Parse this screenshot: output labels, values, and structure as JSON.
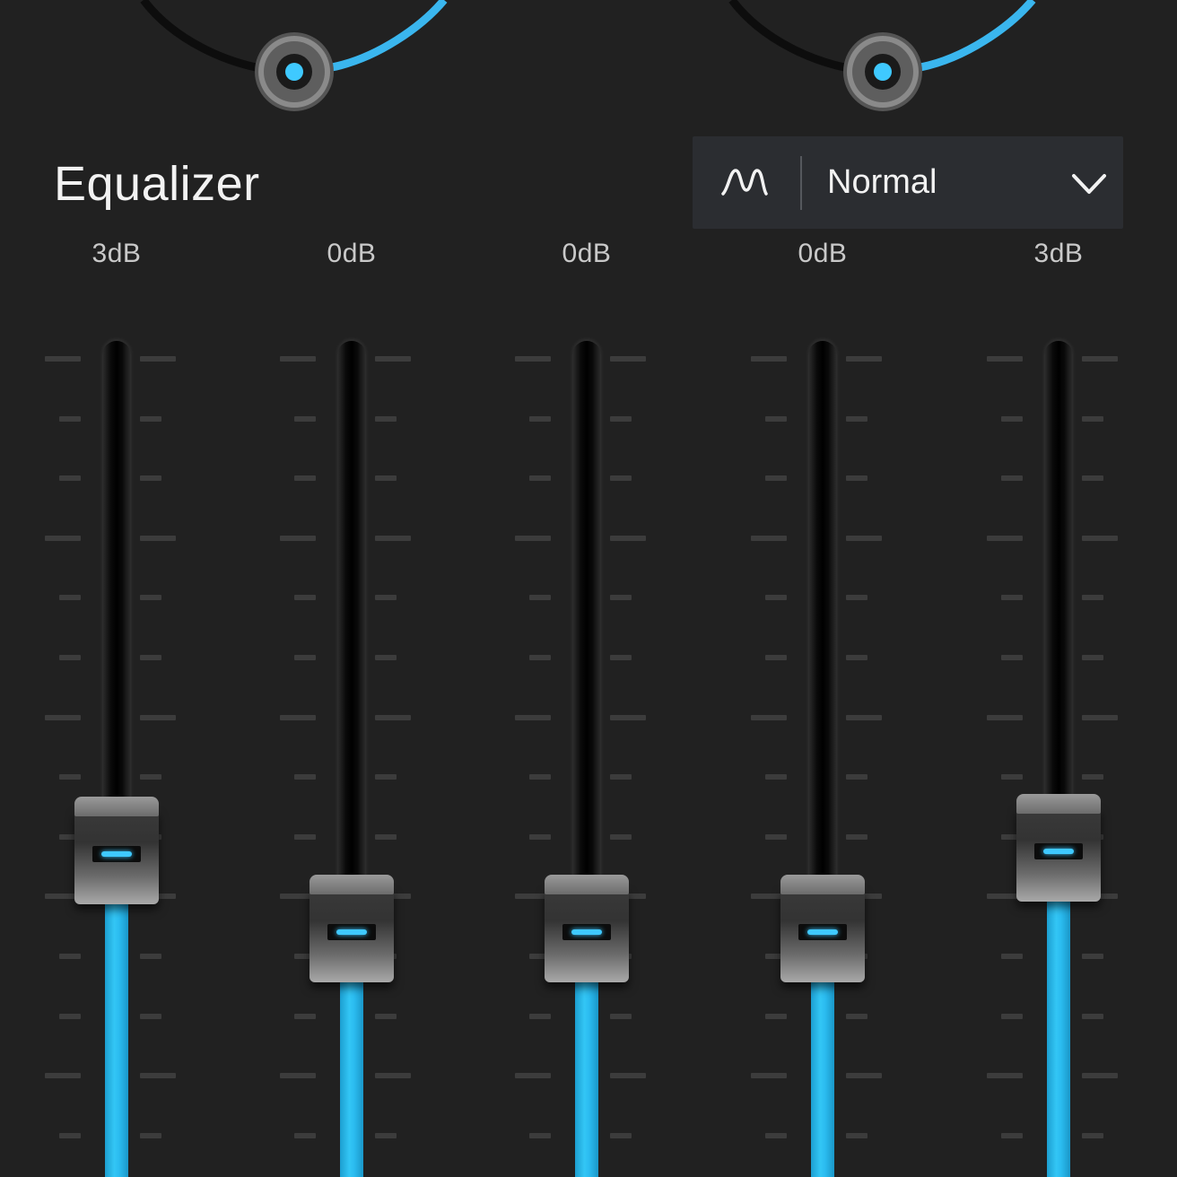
{
  "colors": {
    "background": "#212121",
    "accent": "#2bbcf0",
    "panel": "#2b2d31",
    "text": "#f2f2f2",
    "label": "#c9c9c9"
  },
  "equalizer": {
    "title": "Equalizer",
    "preset": {
      "icon": "waveform-icon",
      "value": "Normal",
      "dropdown_icon": "chevron-down-icon"
    },
    "bands": [
      {
        "label": "3dB",
        "level": 0.375
      },
      {
        "label": "0dB",
        "level": 0.276
      },
      {
        "label": "0dB",
        "level": 0.276
      },
      {
        "label": "0dB",
        "level": 0.276
      },
      {
        "label": "3dB",
        "level": 0.378
      }
    ]
  }
}
